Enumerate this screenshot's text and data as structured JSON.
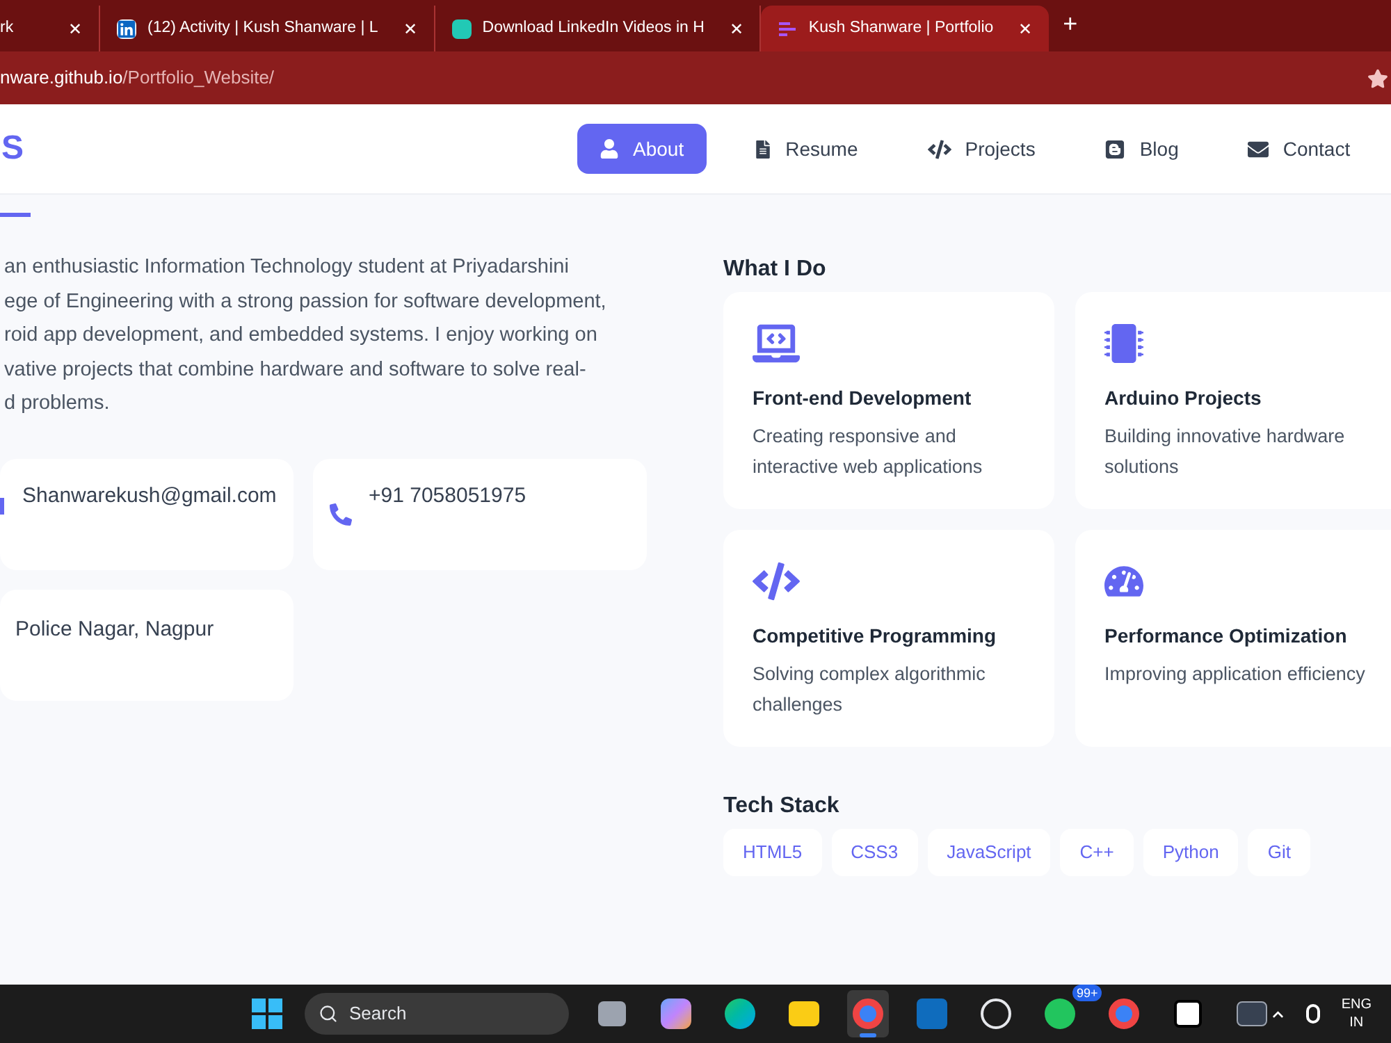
{
  "browser": {
    "tabs": [
      {
        "title": "rk",
        "selected": false
      },
      {
        "title": "(12) Activity | Kush Shanware | L",
        "selected": false
      },
      {
        "title": "Download LinkedIn Videos in H",
        "selected": false
      },
      {
        "title": "Kush Shanware | Portfolio",
        "selected": true
      }
    ],
    "new_tab": "+",
    "close": "✕",
    "address": {
      "host": "nware.github.io",
      "path": "/Portfolio_Website/"
    }
  },
  "site": {
    "logo": "S",
    "nav": [
      {
        "label": "About",
        "selected": true
      },
      {
        "label": "Resume",
        "selected": false
      },
      {
        "label": "Projects",
        "selected": false
      },
      {
        "label": "Blog",
        "selected": false
      },
      {
        "label": "Contact",
        "selected": false
      }
    ]
  },
  "about": {
    "paragraph_lines": [
      "an enthusiastic Information Technology student at Priyadarshini",
      "ege of Engineering with a strong passion for software development,",
      "roid app development, and embedded systems. I enjoy working on",
      "vative projects that combine hardware and software to solve real-",
      "d problems."
    ],
    "contacts": [
      {
        "kind": "email",
        "text": "Shanwarekush@gmail.com"
      },
      {
        "kind": "phone",
        "text": "+91 7058051975"
      },
      {
        "kind": "location",
        "text": "Police Nagar, Nagpur"
      }
    ]
  },
  "what_i_do": {
    "title": "What I Do",
    "services": [
      {
        "title": "Front-end Development",
        "text": "Creating responsive and interactive web applications"
      },
      {
        "title": "Arduino Projects",
        "text": "Building innovative hardware solutions"
      },
      {
        "title": "Competitive Programming",
        "text": "Solving complex algorithmic challenges"
      },
      {
        "title": "Performance Optimization",
        "text": "Improving application efficiency"
      }
    ]
  },
  "tech_stack": {
    "title": "Tech Stack",
    "items": [
      "HTML5",
      "CSS3",
      "JavaScript",
      "C++",
      "Python",
      "Git"
    ]
  },
  "taskbar": {
    "search": "Search",
    "badge": "99+",
    "language": "ENG",
    "region": "IN",
    "apps": [
      {
        "active": false
      },
      {
        "active": false
      },
      {
        "active": false
      },
      {
        "active": false
      },
      {
        "active": true
      },
      {
        "active": false
      },
      {
        "active": false
      },
      {
        "active": false
      },
      {
        "active": false
      },
      {
        "active": false
      },
      {
        "active": false
      }
    ]
  }
}
